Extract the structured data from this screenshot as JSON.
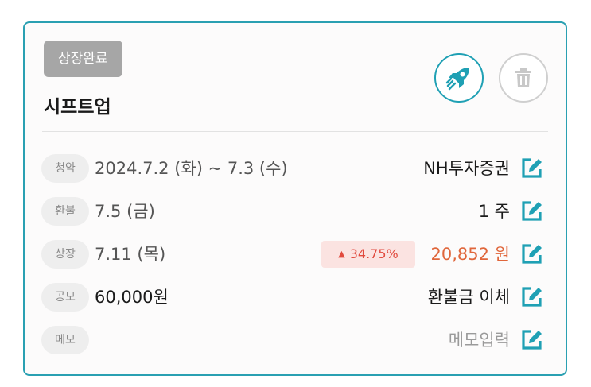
{
  "badge": "상장완료",
  "title": "시프트업",
  "rows": [
    {
      "label": "청약",
      "value": "2024.7.2 (화) ~ 7.3 (수)",
      "right": "NH투자증권"
    },
    {
      "label": "환불",
      "value": "7.5 (금)",
      "right": "1 주"
    },
    {
      "label": "상장",
      "value": "7.11 (목)",
      "change": "34.75%",
      "right": "20,852 원"
    },
    {
      "label": "공모",
      "value": "60,000원",
      "right": "환불금 이체"
    },
    {
      "label": "메모",
      "value": "",
      "right": "메모입력"
    }
  ],
  "icons": {
    "rocket": "rocket-icon",
    "trash": "trash-icon",
    "edit": "edit-icon",
    "change_arrow": "triangle-up-icon"
  },
  "colors": {
    "accent": "#1fa0b4",
    "badge_bg": "#a6a6a6",
    "price": "#e0663b",
    "change_text": "#e14a3e",
    "change_bg": "#fbe3e1"
  }
}
